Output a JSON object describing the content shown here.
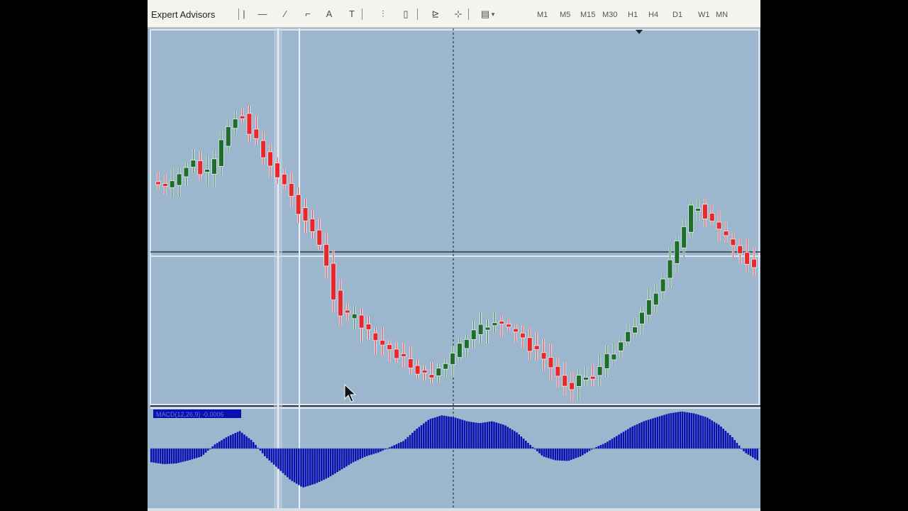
{
  "toolbar": {
    "label": "Expert Advisors",
    "tools": [
      {
        "name": "vertical-line-tool-icon",
        "glyph": "|"
      },
      {
        "name": "horizontal-line-tool-icon",
        "glyph": "—"
      },
      {
        "name": "trendline-tool-icon",
        "glyph": "⁄"
      },
      {
        "name": "fibonacci-tool-icon",
        "glyph": "⌐"
      },
      {
        "name": "text-tool-icon",
        "glyph": "A"
      },
      {
        "name": "text-label-tool-icon",
        "glyph": "T"
      },
      {
        "name": "bar-chart-icon",
        "glyph": "⫶"
      },
      {
        "name": "candlestick-chart-icon",
        "glyph": "▯"
      },
      {
        "name": "line-chart-icon",
        "glyph": "⊵"
      },
      {
        "name": "zoom-chart-icon",
        "glyph": "⊹"
      },
      {
        "name": "templates-icon",
        "glyph": "▤"
      }
    ],
    "timeframes": [
      "M1",
      "M5",
      "M15",
      "M30",
      "H1",
      "H4",
      "D1",
      "W1",
      "MN"
    ]
  },
  "indicator_label": "MACD(12,26,9) -0.0006",
  "colors": {
    "background": "#9cb6ce",
    "bull": "#1e6e2a",
    "bear": "#e8282a",
    "histogram": "#0a10b0",
    "grid": "#dfe8f0"
  },
  "chart_data": {
    "type": "candlestick",
    "candle_count": 86,
    "price_path": [
      0.68,
      0.66,
      0.67,
      0.72,
      0.75,
      0.7,
      0.71,
      0.8,
      0.88,
      0.92,
      0.85,
      0.8,
      0.75,
      0.7,
      0.66,
      0.6,
      0.55,
      0.5,
      0.42,
      0.3,
      0.22,
      0.24,
      0.2,
      0.16,
      0.14,
      0.12,
      0.1,
      0.07,
      0.05,
      0.03,
      0.06,
      0.08,
      0.12,
      0.16,
      0.18,
      0.2,
      0.22,
      0.2,
      0.18,
      0.16,
      0.12,
      0.1,
      0.06,
      0.02,
      0.0,
      0.04,
      0.03,
      0.06,
      0.1,
      0.14,
      0.18,
      0.22,
      0.26,
      0.32,
      0.38,
      0.45,
      0.52,
      0.62,
      0.58,
      0.54,
      0.5,
      0.47,
      0.44,
      0.41
    ],
    "macd_histogram": [
      -0.35,
      -0.4,
      -0.38,
      -0.3,
      -0.2,
      0.1,
      0.3,
      0.45,
      0.2,
      -0.2,
      -0.5,
      -0.8,
      -1.0,
      -0.9,
      -0.75,
      -0.55,
      -0.35,
      -0.2,
      -0.1,
      0.05,
      0.2,
      0.5,
      0.75,
      0.85,
      0.8,
      0.7,
      0.65,
      0.7,
      0.6,
      0.4,
      0.1,
      -0.2,
      -0.3,
      -0.32,
      -0.2,
      0.0,
      0.15,
      0.35,
      0.55,
      0.7,
      0.8,
      0.9,
      0.95,
      0.9,
      0.8,
      0.6,
      0.3,
      -0.1,
      -0.3
    ]
  }
}
